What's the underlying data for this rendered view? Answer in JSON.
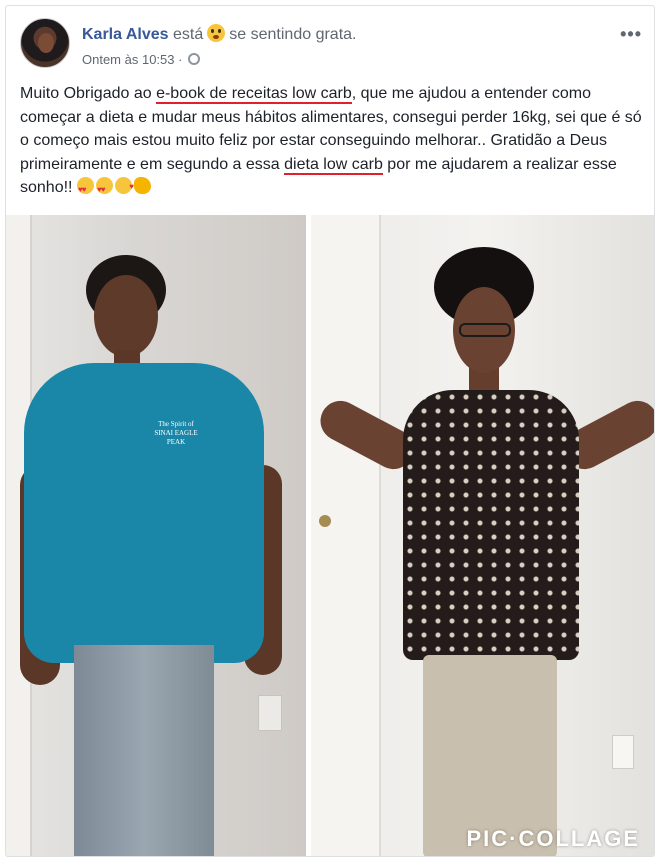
{
  "post": {
    "author_name": "Karla Alves",
    "feeling_prefix": "está",
    "feeling_icon": "astonished-emoji-icon",
    "feeling_text": "se sentindo grata.",
    "timestamp": "Ontem às 10:53",
    "separator": "·",
    "audience_icon": "globe-icon",
    "more_label": "•••",
    "text_parts": {
      "p1": "Muito Obrigado ao ",
      "hl1": "e-book de receitas low carb",
      "p2": ", que me ajudou a entender como começar a dieta e mudar meus hábitos alimentares, consegui perder 16kg, sei que é só o começo mais estou muito feliz por estar conseguindo melhorar.. Gratidão a Deus primeiramente e em segundo a essa ",
      "hl2": "dieta low carb",
      "p3": " por me ajudarem a realizar esse sonho!! "
    },
    "text_emojis": [
      "heart-eyes-emoji-icon",
      "heart-eyes-emoji-icon",
      "kiss-emoji-icon",
      "muscle-emoji-icon"
    ],
    "highlight_color": "#e0202e"
  },
  "photos": {
    "left_alt": "before photo",
    "right_alt": "after photo",
    "shirt_logo": "The Spirit of SINAI EAGLE PEAK",
    "watermark": "PIC·COLLAGE"
  },
  "colors": {
    "link": "#385898",
    "secondary_text": "#606770",
    "border": "#dddfe2"
  }
}
